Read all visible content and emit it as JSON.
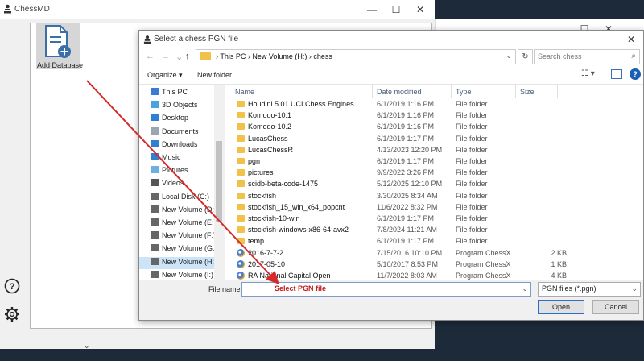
{
  "app": {
    "title": "ChessMD",
    "add_database_label": "Add Database",
    "minimize": "—",
    "maximize": "☐",
    "close": "✕",
    "bottom_chevron": "⌄"
  },
  "dialog": {
    "title": "Select a chess PGN file",
    "close": "✕",
    "nav": {
      "back": "←",
      "forward": "→",
      "down": "⌄",
      "up": "↑"
    },
    "address": {
      "path": "›  This PC  ›  New Volume (H:)  ›  chess",
      "dropdown": "⌄",
      "refresh": "↻"
    },
    "search": {
      "placeholder": "Search chess",
      "icon": "⌕"
    },
    "toolbar": {
      "organize": "Organize ▾",
      "new_folder": "New folder",
      "view": "☷ ▾",
      "help": "?"
    },
    "nav_pane": [
      {
        "label": "This PC",
        "icon": "pc-icon",
        "color": "#3a7bd5"
      },
      {
        "label": "3D Objects",
        "icon": "cube-icon",
        "color": "#4aa3df"
      },
      {
        "label": "Desktop",
        "icon": "desktop-icon",
        "color": "#2f80d1"
      },
      {
        "label": "Documents",
        "icon": "documents-icon",
        "color": "#9aa6b2"
      },
      {
        "label": "Downloads",
        "icon": "downloads-icon",
        "color": "#2f80d1"
      },
      {
        "label": "Music",
        "icon": "music-icon",
        "color": "#2f80d1"
      },
      {
        "label": "Pictures",
        "icon": "pictures-icon",
        "color": "#6bb0e0"
      },
      {
        "label": "Videos",
        "icon": "videos-icon",
        "color": "#555"
      },
      {
        "label": "Local Disk (C:)",
        "icon": "drive-icon",
        "color": "#666"
      },
      {
        "label": "New Volume (D:)",
        "icon": "drive-icon",
        "color": "#666"
      },
      {
        "label": "New Volume (E:)",
        "icon": "drive-icon",
        "color": "#666"
      },
      {
        "label": "New Volume (F:)",
        "icon": "drive-icon",
        "color": "#666"
      },
      {
        "label": "New Volume (G:)",
        "icon": "drive-icon",
        "color": "#666"
      },
      {
        "label": "New Volume (H:)",
        "icon": "drive-icon",
        "color": "#666"
      },
      {
        "label": "New Volume (I:)",
        "icon": "drive-icon",
        "color": "#666"
      }
    ],
    "columns": {
      "name": "Name",
      "date": "Date modified",
      "type": "Type",
      "size": "Size"
    },
    "files": [
      {
        "name": "Houdini 5.01 UCI Chess Engines",
        "date": "6/1/2019 1:16 PM",
        "type": "File folder",
        "size": "",
        "kind": "folder"
      },
      {
        "name": "Komodo-10.1",
        "date": "6/1/2019 1:16 PM",
        "type": "File folder",
        "size": "",
        "kind": "folder"
      },
      {
        "name": "Komodo-10.2",
        "date": "6/1/2019 1:16 PM",
        "type": "File folder",
        "size": "",
        "kind": "folder"
      },
      {
        "name": "LucasChess",
        "date": "6/1/2019 1:17 PM",
        "type": "File folder",
        "size": "",
        "kind": "folder"
      },
      {
        "name": "LucasChessR",
        "date": "4/13/2023 12:20 PM",
        "type": "File folder",
        "size": "",
        "kind": "folder"
      },
      {
        "name": "pgn",
        "date": "6/1/2019 1:17 PM",
        "type": "File folder",
        "size": "",
        "kind": "folder"
      },
      {
        "name": "pictures",
        "date": "9/9/2022 3:26 PM",
        "type": "File folder",
        "size": "",
        "kind": "folder"
      },
      {
        "name": "scidb-beta-code-1475",
        "date": "5/12/2025 12:10 PM",
        "type": "File folder",
        "size": "",
        "kind": "folder"
      },
      {
        "name": "stockfish",
        "date": "3/30/2025 8:34 AM",
        "type": "File folder",
        "size": "",
        "kind": "folder"
      },
      {
        "name": "stockfish_15_win_x64_popcnt",
        "date": "11/6/2022 8:32 PM",
        "type": "File folder",
        "size": "",
        "kind": "folder"
      },
      {
        "name": "stockfish-10-win",
        "date": "6/1/2019 1:17 PM",
        "type": "File folder",
        "size": "",
        "kind": "folder"
      },
      {
        "name": "stockfish-windows-x86-64-avx2",
        "date": "7/8/2024 11:21 AM",
        "type": "File folder",
        "size": "",
        "kind": "folder"
      },
      {
        "name": "temp",
        "date": "6/1/2019 1:17 PM",
        "type": "File folder",
        "size": "",
        "kind": "folder"
      },
      {
        "name": "2016-7-7-2",
        "date": "7/15/2016 10:10 PM",
        "type": "Program ChessX",
        "size": "2 KB",
        "kind": "pgn"
      },
      {
        "name": "2017-05-10",
        "date": "5/10/2017 8:53 PM",
        "type": "Program ChessX",
        "size": "1 KB",
        "kind": "pgn"
      },
      {
        "name": "RA National Capital Open",
        "date": "11/7/2022 8:03 AM",
        "type": "Program ChessX",
        "size": "4 KB",
        "kind": "pgn"
      }
    ],
    "filename_label": "File name:",
    "filename_value": "Select PGN file",
    "filter_value": "PGN files (*.pgn)",
    "open_label": "Open",
    "cancel_label": "Cancel"
  },
  "colors": {
    "annotation_arrow": "#d42a2a",
    "selection": "#cce4f7",
    "accent": "#1a5fb4"
  }
}
